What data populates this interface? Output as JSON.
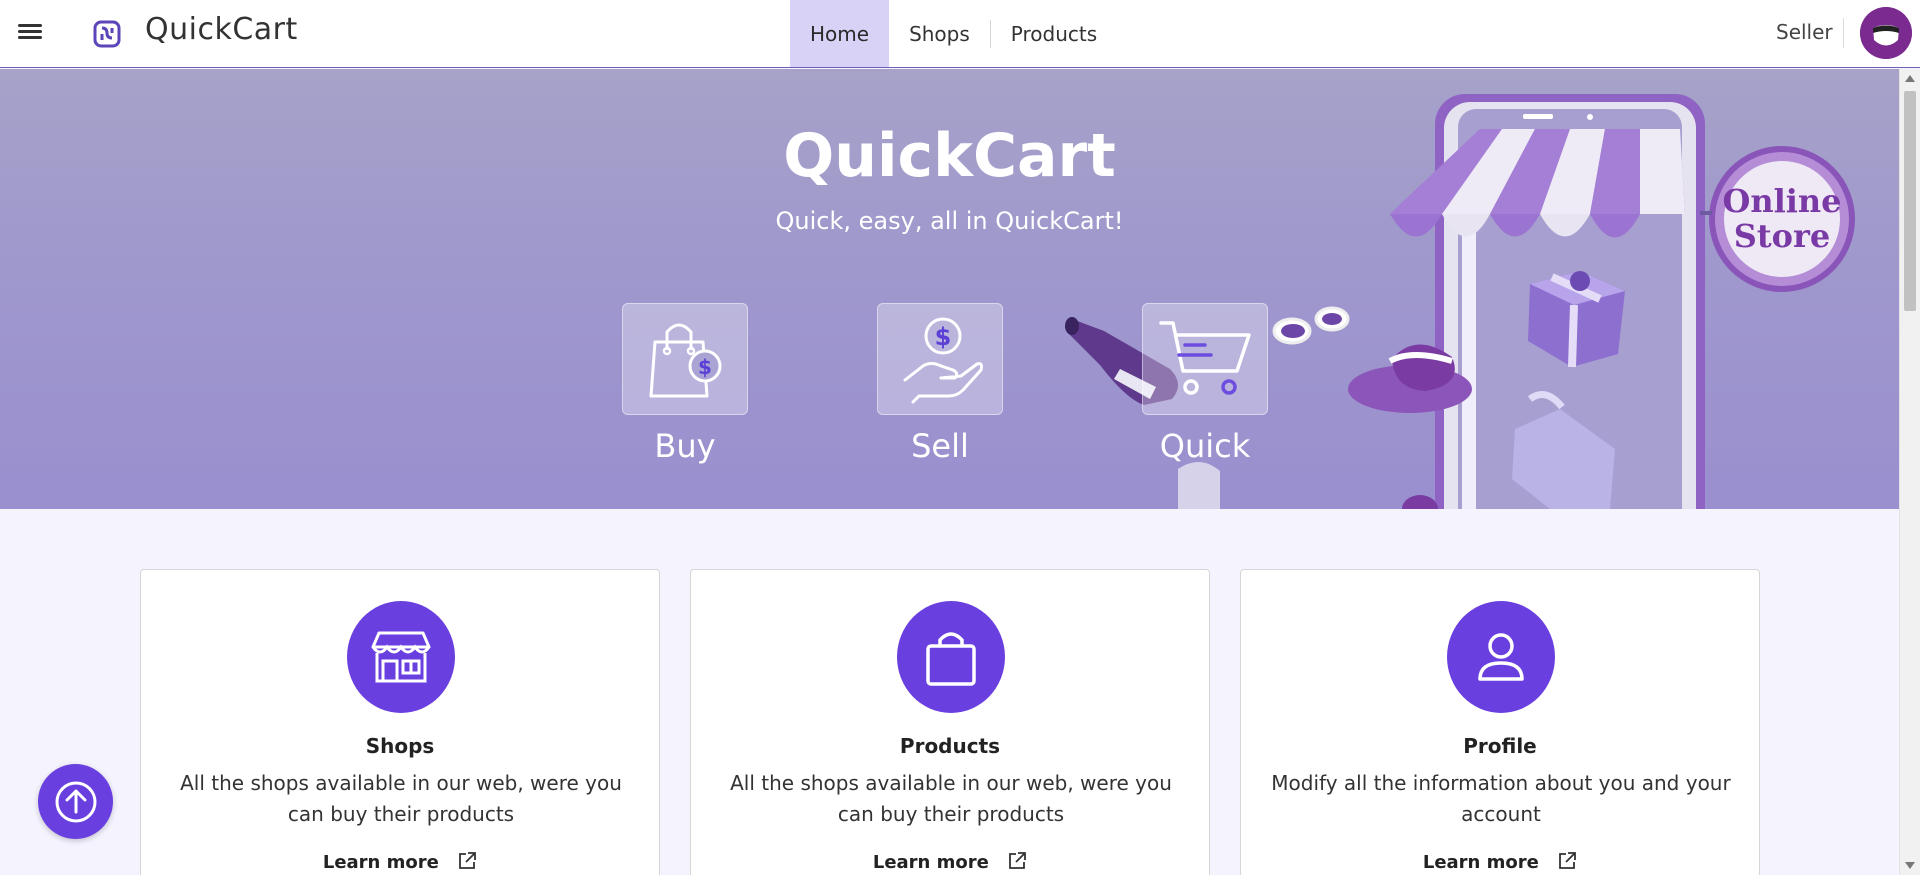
{
  "header": {
    "brand": "QuickCart",
    "nav": [
      {
        "label": "Home",
        "active": true
      },
      {
        "label": "Shops",
        "active": false
      },
      {
        "label": "Products",
        "active": false
      }
    ],
    "role_label": "Seller"
  },
  "hero": {
    "title": "QuickCart",
    "subtitle": "Quick, easy, all in QuickCart!",
    "features": [
      {
        "label": "Buy",
        "icon": "shopping-bag-dollar-icon"
      },
      {
        "label": "Sell",
        "icon": "hand-coin-icon"
      },
      {
        "label": "Quick",
        "icon": "fast-cart-icon"
      }
    ],
    "sign_text": [
      "Online",
      "Store"
    ]
  },
  "cards": [
    {
      "title": "Shops",
      "icon": "store-icon",
      "text": "All the shops available in our web, were you can buy their products",
      "link": "Learn more"
    },
    {
      "title": "Products",
      "icon": "bag-icon",
      "text": "All the shops available in our web, were you can buy their products",
      "link": "Learn more"
    },
    {
      "title": "Profile",
      "icon": "user-icon",
      "text": "Modify all the information about you and your account",
      "link": "Learn more"
    }
  ],
  "colors": {
    "accent": "#6a3fe0",
    "nav_active": "#d8d2f7",
    "hero": "#9f98cd"
  }
}
